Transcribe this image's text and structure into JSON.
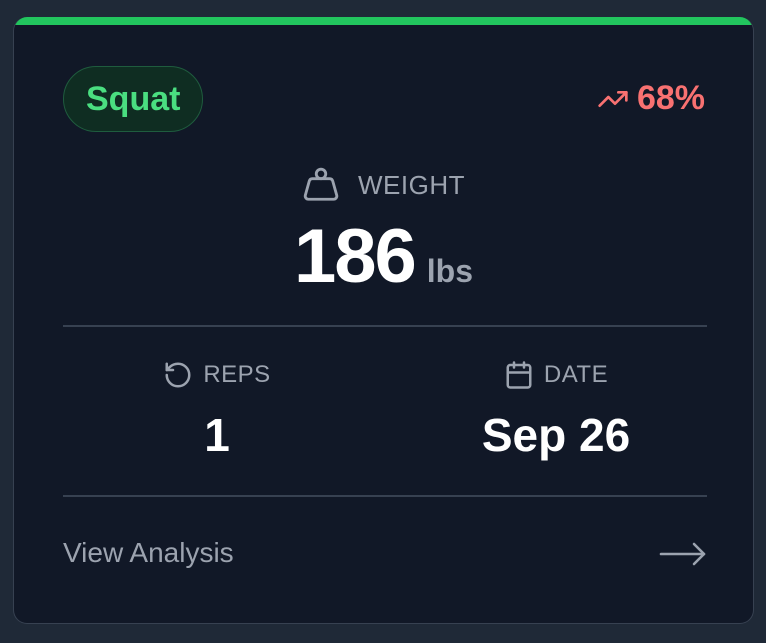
{
  "card": {
    "accent_color": "#22c55e",
    "exercise": "Squat",
    "trend": {
      "icon": "trending-up-icon",
      "value": "68%",
      "color": "#f87171"
    },
    "weight": {
      "icon": "weight-icon",
      "label": "WEIGHT",
      "value": "186",
      "unit": "lbs"
    },
    "reps": {
      "icon": "rotate-ccw-icon",
      "label": "REPS",
      "value": "1"
    },
    "date": {
      "icon": "calendar-icon",
      "label": "DATE",
      "value": "Sep 26"
    },
    "footer": {
      "link_label": "View Analysis",
      "arrow_icon": "arrow-right-icon"
    }
  }
}
